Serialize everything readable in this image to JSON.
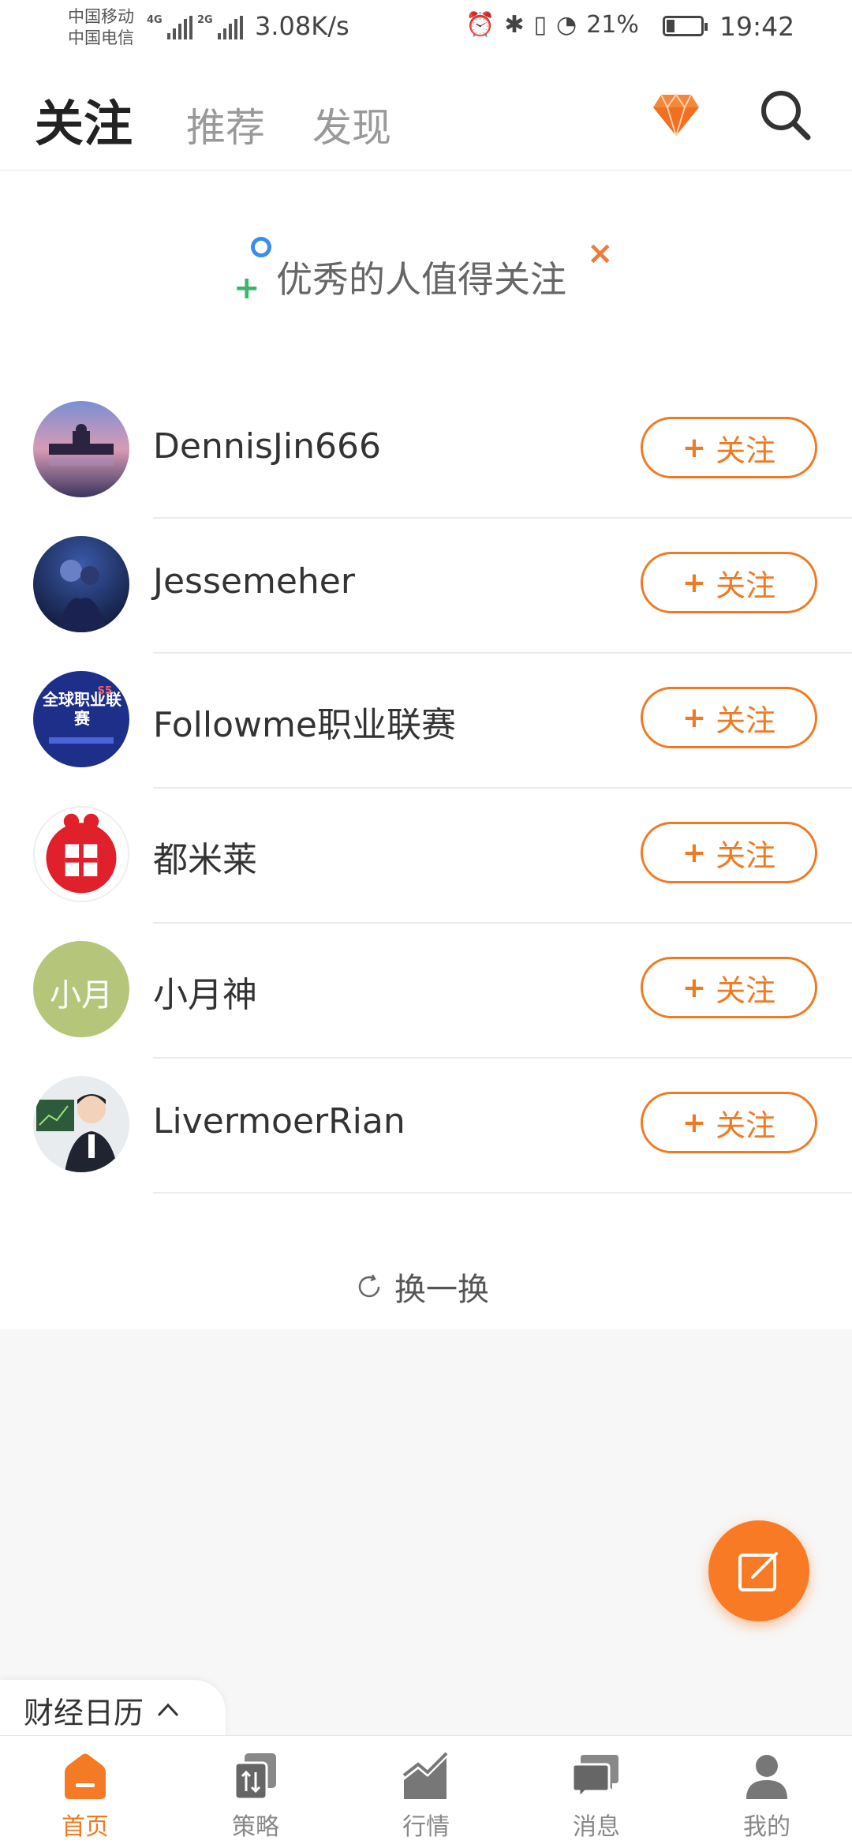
{
  "status_bar": {
    "carrier_1": "中国移动",
    "carrier_2": "中国电信",
    "net_1": "4G",
    "net_2": "2G",
    "net_speed": "3.08K/s",
    "battery": "21%",
    "battery_level": 0.21,
    "time": "19:42"
  },
  "header": {
    "tabs": [
      {
        "label": "关注",
        "active": true
      },
      {
        "label": "推荐",
        "active": false
      },
      {
        "label": "发现",
        "active": false
      }
    ],
    "icons": [
      "diamond-icon",
      "search-icon"
    ]
  },
  "banner": {
    "text": "优秀的人值得关注"
  },
  "users": [
    {
      "name": "DennisJin666",
      "follow": "关注"
    },
    {
      "name": "Jessemeher",
      "follow": "关注"
    },
    {
      "name": "Followme职业联赛",
      "follow": "关注",
      "avatar_text": "全球职业联赛",
      "avatar_badge": "S5"
    },
    {
      "name": "都米莱",
      "follow": "关注"
    },
    {
      "name": "小月神",
      "follow": "关注",
      "avatar_text": "小月"
    },
    {
      "name": "LivermoerRian",
      "follow": "关注"
    }
  ],
  "follow_prefix": "+",
  "refresh": {
    "label": "换一换"
  },
  "calendar": {
    "label": "财经日历"
  },
  "bottom_nav": [
    {
      "label": "首页",
      "icon": "home-icon",
      "active": true
    },
    {
      "label": "策略",
      "icon": "strategy-icon",
      "active": false
    },
    {
      "label": "行情",
      "icon": "market-icon",
      "active": false
    },
    {
      "label": "消息",
      "icon": "message-icon",
      "active": false
    },
    {
      "label": "我的",
      "icon": "profile-icon",
      "active": false
    }
  ],
  "colors": {
    "accent": "#f07a22",
    "fab": "#f97a24",
    "text": "#333333",
    "muted": "#999999"
  }
}
